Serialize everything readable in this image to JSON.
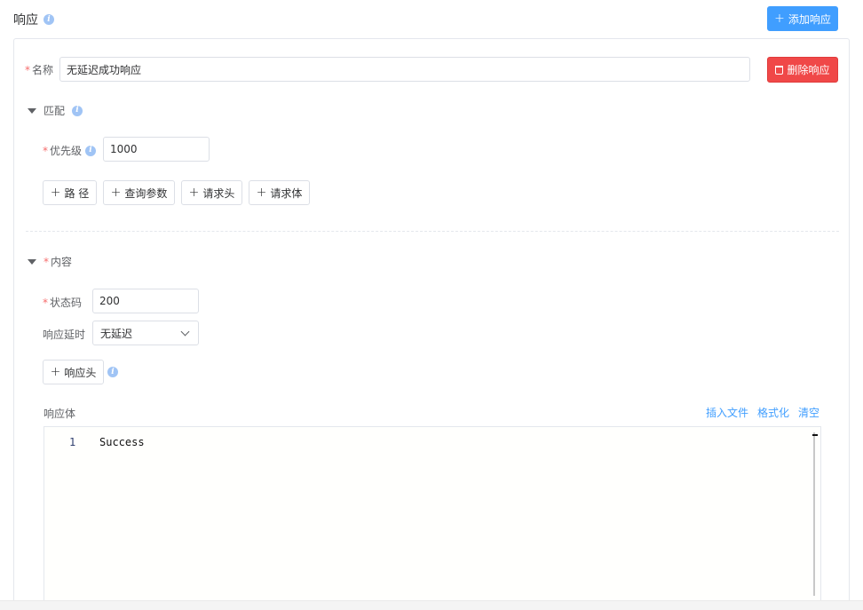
{
  "header": {
    "title": "响应",
    "add_button": "添加响应"
  },
  "response": {
    "name_label": "名称",
    "name_value": "无延迟成功响应",
    "delete_button": "删除响应"
  },
  "match": {
    "title": "匹配",
    "priority_label": "优先级",
    "priority_value": "1000",
    "buttons": [
      "路 径",
      "查询参数",
      "请求头",
      "请求体"
    ]
  },
  "content": {
    "title": "内容",
    "status_label": "状态码",
    "status_value": "200",
    "delay_label": "响应延时",
    "delay_value": "无延迟",
    "headers_button": "响应头",
    "body_label": "响应体",
    "body_links": [
      "插入文件",
      "格式化",
      "清空"
    ],
    "editor": {
      "line_number": "1",
      "line_text": "Success"
    }
  },
  "colors": {
    "primary": "#409eff",
    "danger": "#f04848",
    "required": "#f56c6c"
  }
}
